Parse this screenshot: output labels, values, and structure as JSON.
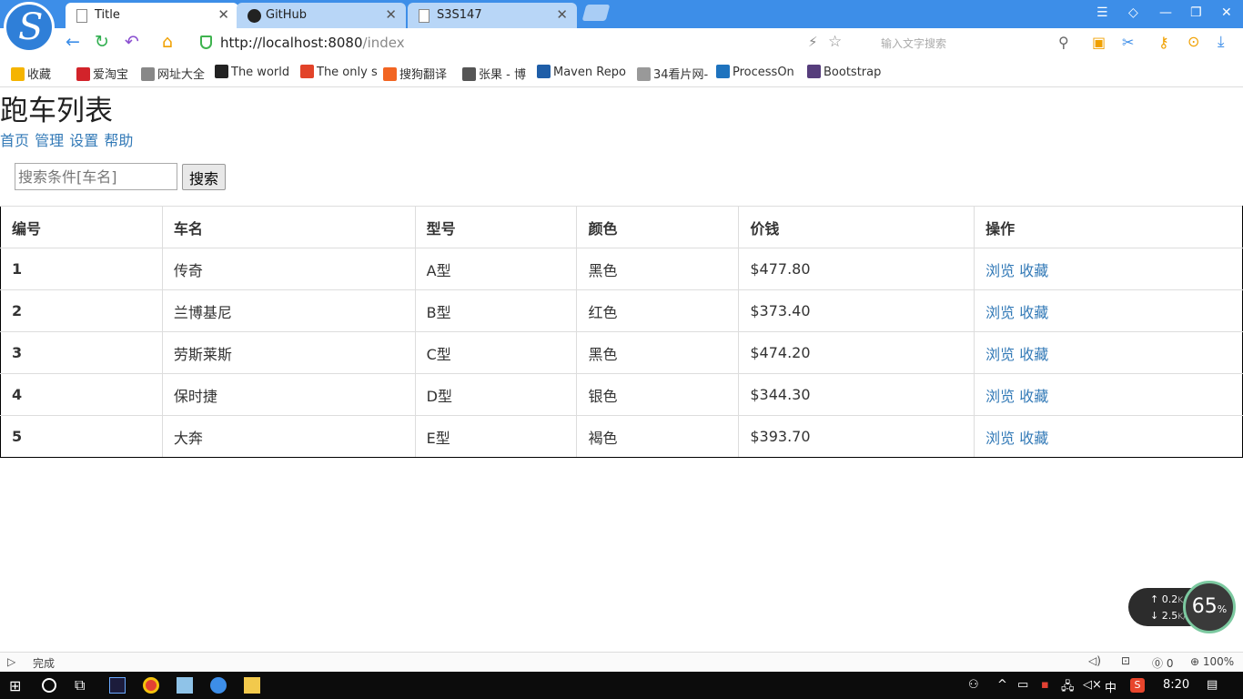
{
  "browser": {
    "tabs": [
      {
        "label": "Title",
        "active": true
      },
      {
        "label": "GitHub",
        "active": false
      },
      {
        "label": "S3S147",
        "active": false
      }
    ],
    "url_host": "http://localhost:8080",
    "url_path": "/index",
    "search_placeholder": "输入文字搜索",
    "bookmarks": [
      {
        "label": "收藏",
        "color": "#f5b400"
      },
      {
        "label": "爱淘宝",
        "color": "#d2232a"
      },
      {
        "label": "网址大全",
        "color": "#888888"
      },
      {
        "label": "The world",
        "color": "#222222"
      },
      {
        "label": "The only s",
        "color": "#e24329"
      },
      {
        "label": "搜狗翻译",
        "color": "#f26522"
      },
      {
        "label": "张果 - 博",
        "color": "#555555"
      },
      {
        "label": "Maven Repo",
        "color": "#1f5ea8"
      },
      {
        "label": "34看片网-",
        "color": "#999999"
      },
      {
        "label": "ProcessOn",
        "color": "#1e73be"
      },
      {
        "label": "Bootstrap",
        "color": "#563d7c"
      }
    ]
  },
  "page": {
    "title": "跑车列表",
    "nav": [
      "首页",
      "管理",
      "设置",
      "帮助"
    ],
    "search": {
      "placeholder": "搜索条件[车名]",
      "button": "搜索"
    },
    "table": {
      "headers": [
        "编号",
        "车名",
        "型号",
        "颜色",
        "价钱",
        "操作"
      ],
      "rows": [
        {
          "id": "1",
          "name": "传奇",
          "model": "A型",
          "color": "黑色",
          "price": "$477.80"
        },
        {
          "id": "2",
          "name": "兰博基尼",
          "model": "B型",
          "color": "红色",
          "price": "$373.40"
        },
        {
          "id": "3",
          "name": "劳斯莱斯",
          "model": "C型",
          "color": "黑色",
          "price": "$474.20"
        },
        {
          "id": "4",
          "name": "保时捷",
          "model": "D型",
          "color": "银色",
          "price": "$344.30"
        },
        {
          "id": "5",
          "name": "大奔",
          "model": "E型",
          "color": "褐色",
          "price": "$393.70"
        }
      ],
      "action_view": "浏览",
      "action_fav": "收藏"
    }
  },
  "widget": {
    "up": "0.2",
    "down": "2.5",
    "unit": "K/s",
    "percent": "65",
    "pct_sign": "%"
  },
  "status": {
    "left": "完成",
    "zoom": "100%",
    "count": "0"
  },
  "taskbar": {
    "time": "8:20",
    "ime": "中"
  },
  "accent": "#337ab7"
}
